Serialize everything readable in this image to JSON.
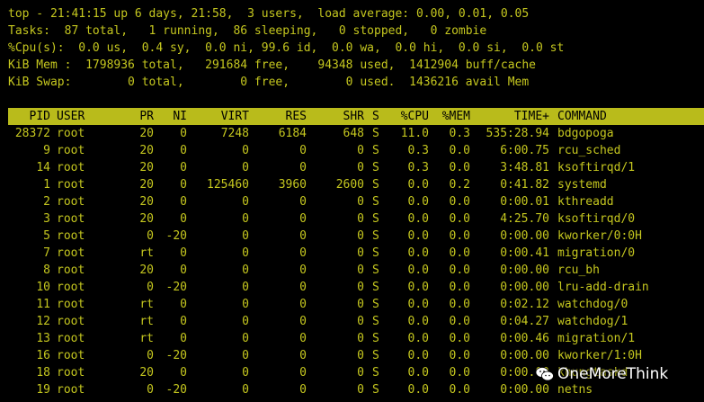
{
  "summary": {
    "line1": "top - 21:41:15 up 6 days, 21:58,  3 users,  load average: 0.00, 0.01, 0.05",
    "line2": "Tasks:  87 total,   1 running,  86 sleeping,   0 stopped,   0 zombie",
    "line3": "%Cpu(s):  0.0 us,  0.4 sy,  0.0 ni, 99.6 id,  0.0 wa,  0.0 hi,  0.0 si,  0.0 st",
    "line4": "KiB Mem :  1798936 total,   291684 free,    94348 used,  1412904 buff/cache",
    "line5": "KiB Swap:        0 total,        0 free,        0 used.  1436216 avail Mem"
  },
  "table": {
    "headers": [
      "PID",
      "USER",
      "PR",
      "NI",
      "VIRT",
      "RES",
      "SHR",
      "S",
      "%CPU",
      "%MEM",
      "TIME+",
      "COMMAND"
    ],
    "rows": [
      [
        "28372",
        "root",
        "20",
        "0",
        "7248",
        "6184",
        "648",
        "S",
        "11.0",
        "0.3",
        "535:28.94",
        "bdgopoga"
      ],
      [
        "9",
        "root",
        "20",
        "0",
        "0",
        "0",
        "0",
        "S",
        "0.3",
        "0.0",
        "6:00.75",
        "rcu_sched"
      ],
      [
        "14",
        "root",
        "20",
        "0",
        "0",
        "0",
        "0",
        "S",
        "0.3",
        "0.0",
        "3:48.81",
        "ksoftirqd/1"
      ],
      [
        "1",
        "root",
        "20",
        "0",
        "125460",
        "3960",
        "2600",
        "S",
        "0.0",
        "0.2",
        "0:41.82",
        "systemd"
      ],
      [
        "2",
        "root",
        "20",
        "0",
        "0",
        "0",
        "0",
        "S",
        "0.0",
        "0.0",
        "0:00.01",
        "kthreadd"
      ],
      [
        "3",
        "root",
        "20",
        "0",
        "0",
        "0",
        "0",
        "S",
        "0.0",
        "0.0",
        "4:25.70",
        "ksoftirqd/0"
      ],
      [
        "5",
        "root",
        "0",
        "-20",
        "0",
        "0",
        "0",
        "S",
        "0.0",
        "0.0",
        "0:00.00",
        "kworker/0:0H"
      ],
      [
        "7",
        "root",
        "rt",
        "0",
        "0",
        "0",
        "0",
        "S",
        "0.0",
        "0.0",
        "0:00.41",
        "migration/0"
      ],
      [
        "8",
        "root",
        "20",
        "0",
        "0",
        "0",
        "0",
        "S",
        "0.0",
        "0.0",
        "0:00.00",
        "rcu_bh"
      ],
      [
        "10",
        "root",
        "0",
        "-20",
        "0",
        "0",
        "0",
        "S",
        "0.0",
        "0.0",
        "0:00.00",
        "lru-add-drain"
      ],
      [
        "11",
        "root",
        "rt",
        "0",
        "0",
        "0",
        "0",
        "S",
        "0.0",
        "0.0",
        "0:02.12",
        "watchdog/0"
      ],
      [
        "12",
        "root",
        "rt",
        "0",
        "0",
        "0",
        "0",
        "S",
        "0.0",
        "0.0",
        "0:04.27",
        "watchdog/1"
      ],
      [
        "13",
        "root",
        "rt",
        "0",
        "0",
        "0",
        "0",
        "S",
        "0.0",
        "0.0",
        "0:00.46",
        "migration/1"
      ],
      [
        "16",
        "root",
        "0",
        "-20",
        "0",
        "0",
        "0",
        "S",
        "0.0",
        "0.0",
        "0:00.00",
        "kworker/1:0H"
      ],
      [
        "18",
        "root",
        "20",
        "0",
        "0",
        "0",
        "0",
        "S",
        "0.0",
        "0.0",
        "0:00.00",
        "khungtaskd"
      ],
      [
        "19",
        "root",
        "0",
        "-20",
        "0",
        "0",
        "0",
        "S",
        "0.0",
        "0.0",
        "0:00.00",
        "netns"
      ]
    ]
  },
  "watermark": {
    "icon": "wechat-icon",
    "text": "OneMoreThink"
  },
  "colors": {
    "background": "#000000",
    "text": "#c5c71f",
    "header_bg": "#b9bb1b",
    "header_text": "#000000"
  }
}
